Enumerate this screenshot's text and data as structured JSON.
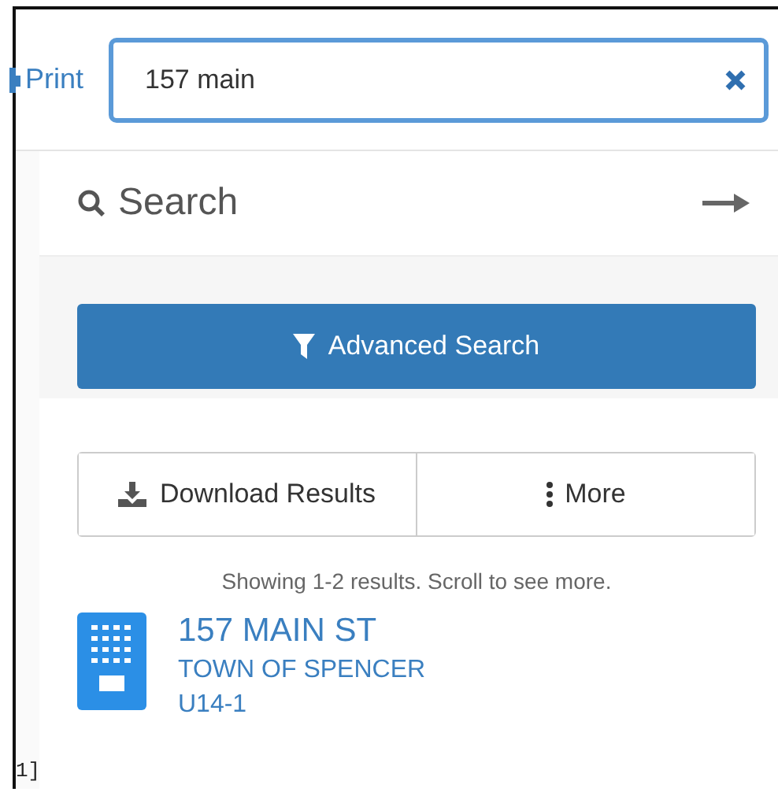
{
  "toolbar": {
    "print_link": "Print"
  },
  "search_field": {
    "value": "157 main"
  },
  "panel": {
    "title": "Search",
    "advanced_search_button": "Advanced Search",
    "actions": [
      {
        "kind": "download",
        "label": "Download Results"
      },
      {
        "kind": "more",
        "label": "More"
      }
    ],
    "results_note": "Showing 1-2 results. Scroll to see more.",
    "results": [
      {
        "title": "157 MAIN ST",
        "town": "TOWN OF SPENCER",
        "id": "U14-1"
      }
    ]
  },
  "map_fragment": "1]"
}
